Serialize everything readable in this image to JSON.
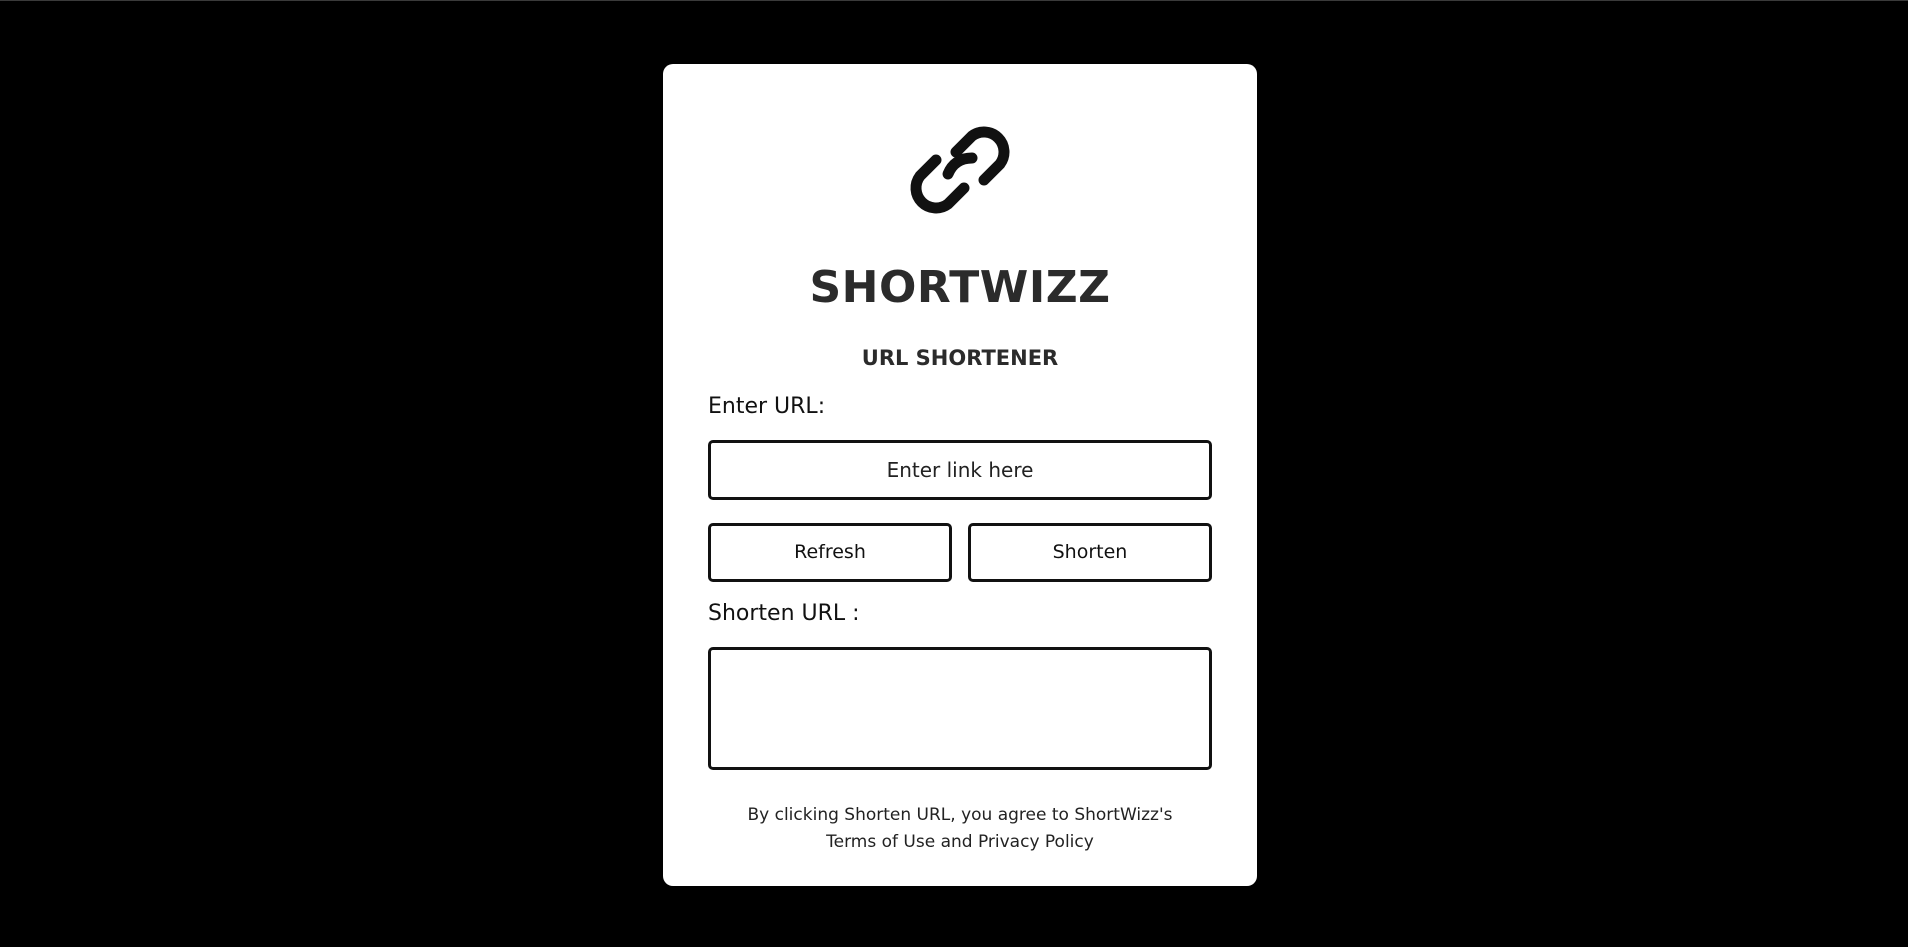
{
  "app": {
    "title": "SHORTWIZZ",
    "subtitle": "URL SHORTENER",
    "logo_icon": "link-icon"
  },
  "form": {
    "enter_label": "Enter URL:",
    "input_placeholder": "Enter link here",
    "input_value": "",
    "refresh_label": "Refresh",
    "shorten_label": "Shorten",
    "result_label": "Shorten URL :",
    "result_value": ""
  },
  "footer": {
    "line1": "By clicking Shorten URL, you agree to ShortWizz's",
    "line2": "Terms of Use and Privacy Policy"
  },
  "colors": {
    "background": "#000000",
    "card": "#ffffff",
    "text_dark": "#2b2b2b",
    "border": "#111111"
  }
}
